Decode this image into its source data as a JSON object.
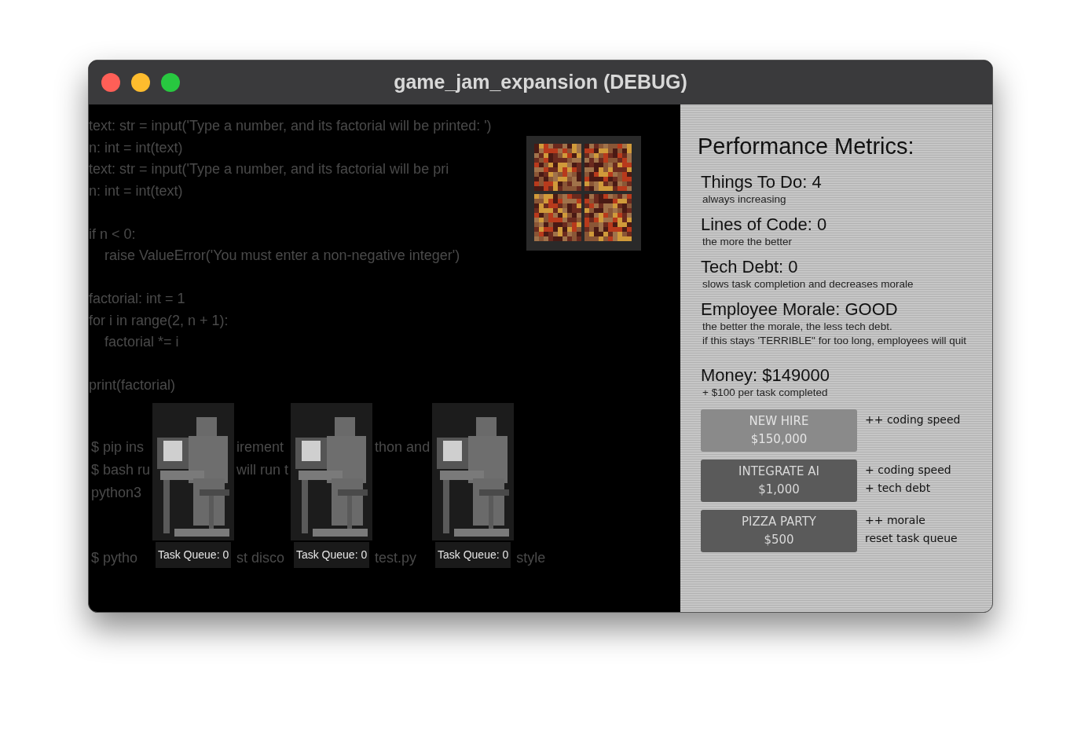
{
  "window": {
    "title": "game_jam_expansion (DEBUG)"
  },
  "code_blocks": [
    [
      "text: str = input('Type a number, and its factorial will be printed: ')",
      "n: int = int(text)",
      "text: str = input('Type a number, and its factorial will be pri",
      "n: int = int(text)"
    ],
    [
      "if n < 0:",
      "    raise ValueError('You must enter a non-negative integer')"
    ],
    [
      "factorial: int = 1",
      "for i in range(2, n + 1):",
      "    factorial *= i"
    ],
    [
      "print(factorial)"
    ]
  ],
  "covered_code": [
    {
      "upper": [
        "$ pip ins",
        "$ bash ru",
        "python3"
      ],
      "bottom": "$ pytho"
    },
    {
      "upper": [
        "irement",
        "will run t"
      ],
      "bottom": "st disco"
    },
    {
      "upper": [
        "thon and"
      ],
      "bottom": "test.py"
    },
    {
      "bottom": "style"
    }
  ],
  "workers": [
    {
      "task_queue": "Task Queue: 0"
    },
    {
      "task_queue": "Task Queue: 0"
    },
    {
      "task_queue": "Task Queue: 0"
    }
  ],
  "metrics": {
    "title": "Performance Metrics:",
    "items": [
      {
        "label": "Things To Do: 4",
        "notes": [
          "always increasing"
        ]
      },
      {
        "label": "Lines of Code: 0",
        "notes": [
          "the more the better"
        ]
      },
      {
        "label": "Tech Debt: 0",
        "notes": [
          "slows task completion and decreases morale"
        ]
      },
      {
        "label": "Employee Morale: GOOD",
        "notes": [
          "the better the morale, the less tech debt.",
          "if this stays 'TERRIBLE\" for too long, employees will quit"
        ]
      },
      {
        "label": "Money: $149000",
        "notes": [
          "+ $100 per task completed"
        ]
      }
    ]
  },
  "purchases": [
    {
      "label": "NEW HIRE",
      "price": "$150,000",
      "disabled": true,
      "effects": [
        "++ coding speed"
      ]
    },
    {
      "label": "INTEGRATE AI",
      "price": "$1,000",
      "disabled": false,
      "effects": [
        "+ coding speed",
        "+ tech debt"
      ]
    },
    {
      "label": "PIZZA PARTY",
      "price": "$500",
      "disabled": false,
      "effects": [
        "++ morale",
        "reset task queue"
      ]
    }
  ]
}
